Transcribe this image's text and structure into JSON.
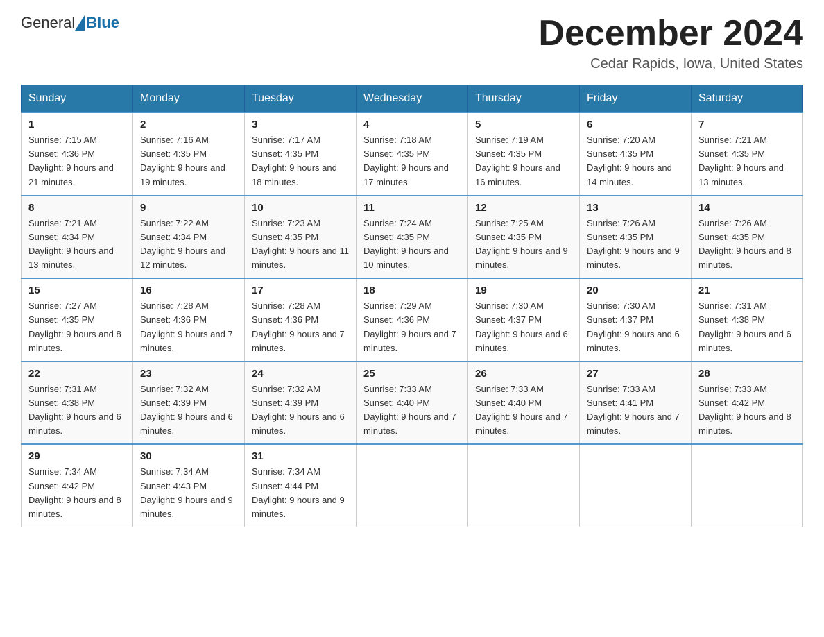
{
  "header": {
    "logo_general": "General",
    "logo_blue": "Blue",
    "month_title": "December 2024",
    "location": "Cedar Rapids, Iowa, United States"
  },
  "weekdays": [
    "Sunday",
    "Monday",
    "Tuesday",
    "Wednesday",
    "Thursday",
    "Friday",
    "Saturday"
  ],
  "weeks": [
    [
      {
        "day": "1",
        "sunrise": "7:15 AM",
        "sunset": "4:36 PM",
        "daylight": "9 hours and 21 minutes."
      },
      {
        "day": "2",
        "sunrise": "7:16 AM",
        "sunset": "4:35 PM",
        "daylight": "9 hours and 19 minutes."
      },
      {
        "day": "3",
        "sunrise": "7:17 AM",
        "sunset": "4:35 PM",
        "daylight": "9 hours and 18 minutes."
      },
      {
        "day": "4",
        "sunrise": "7:18 AM",
        "sunset": "4:35 PM",
        "daylight": "9 hours and 17 minutes."
      },
      {
        "day": "5",
        "sunrise": "7:19 AM",
        "sunset": "4:35 PM",
        "daylight": "9 hours and 16 minutes."
      },
      {
        "day": "6",
        "sunrise": "7:20 AM",
        "sunset": "4:35 PM",
        "daylight": "9 hours and 14 minutes."
      },
      {
        "day": "7",
        "sunrise": "7:21 AM",
        "sunset": "4:35 PM",
        "daylight": "9 hours and 13 minutes."
      }
    ],
    [
      {
        "day": "8",
        "sunrise": "7:21 AM",
        "sunset": "4:34 PM",
        "daylight": "9 hours and 13 minutes."
      },
      {
        "day": "9",
        "sunrise": "7:22 AM",
        "sunset": "4:34 PM",
        "daylight": "9 hours and 12 minutes."
      },
      {
        "day": "10",
        "sunrise": "7:23 AM",
        "sunset": "4:35 PM",
        "daylight": "9 hours and 11 minutes."
      },
      {
        "day": "11",
        "sunrise": "7:24 AM",
        "sunset": "4:35 PM",
        "daylight": "9 hours and 10 minutes."
      },
      {
        "day": "12",
        "sunrise": "7:25 AM",
        "sunset": "4:35 PM",
        "daylight": "9 hours and 9 minutes."
      },
      {
        "day": "13",
        "sunrise": "7:26 AM",
        "sunset": "4:35 PM",
        "daylight": "9 hours and 9 minutes."
      },
      {
        "day": "14",
        "sunrise": "7:26 AM",
        "sunset": "4:35 PM",
        "daylight": "9 hours and 8 minutes."
      }
    ],
    [
      {
        "day": "15",
        "sunrise": "7:27 AM",
        "sunset": "4:35 PM",
        "daylight": "9 hours and 8 minutes."
      },
      {
        "day": "16",
        "sunrise": "7:28 AM",
        "sunset": "4:36 PM",
        "daylight": "9 hours and 7 minutes."
      },
      {
        "day": "17",
        "sunrise": "7:28 AM",
        "sunset": "4:36 PM",
        "daylight": "9 hours and 7 minutes."
      },
      {
        "day": "18",
        "sunrise": "7:29 AM",
        "sunset": "4:36 PM",
        "daylight": "9 hours and 7 minutes."
      },
      {
        "day": "19",
        "sunrise": "7:30 AM",
        "sunset": "4:37 PM",
        "daylight": "9 hours and 6 minutes."
      },
      {
        "day": "20",
        "sunrise": "7:30 AM",
        "sunset": "4:37 PM",
        "daylight": "9 hours and 6 minutes."
      },
      {
        "day": "21",
        "sunrise": "7:31 AM",
        "sunset": "4:38 PM",
        "daylight": "9 hours and 6 minutes."
      }
    ],
    [
      {
        "day": "22",
        "sunrise": "7:31 AM",
        "sunset": "4:38 PM",
        "daylight": "9 hours and 6 minutes."
      },
      {
        "day": "23",
        "sunrise": "7:32 AM",
        "sunset": "4:39 PM",
        "daylight": "9 hours and 6 minutes."
      },
      {
        "day": "24",
        "sunrise": "7:32 AM",
        "sunset": "4:39 PM",
        "daylight": "9 hours and 6 minutes."
      },
      {
        "day": "25",
        "sunrise": "7:33 AM",
        "sunset": "4:40 PM",
        "daylight": "9 hours and 7 minutes."
      },
      {
        "day": "26",
        "sunrise": "7:33 AM",
        "sunset": "4:40 PM",
        "daylight": "9 hours and 7 minutes."
      },
      {
        "day": "27",
        "sunrise": "7:33 AM",
        "sunset": "4:41 PM",
        "daylight": "9 hours and 7 minutes."
      },
      {
        "day": "28",
        "sunrise": "7:33 AM",
        "sunset": "4:42 PM",
        "daylight": "9 hours and 8 minutes."
      }
    ],
    [
      {
        "day": "29",
        "sunrise": "7:34 AM",
        "sunset": "4:42 PM",
        "daylight": "9 hours and 8 minutes."
      },
      {
        "day": "30",
        "sunrise": "7:34 AM",
        "sunset": "4:43 PM",
        "daylight": "9 hours and 9 minutes."
      },
      {
        "day": "31",
        "sunrise": "7:34 AM",
        "sunset": "4:44 PM",
        "daylight": "9 hours and 9 minutes."
      },
      null,
      null,
      null,
      null
    ]
  ]
}
